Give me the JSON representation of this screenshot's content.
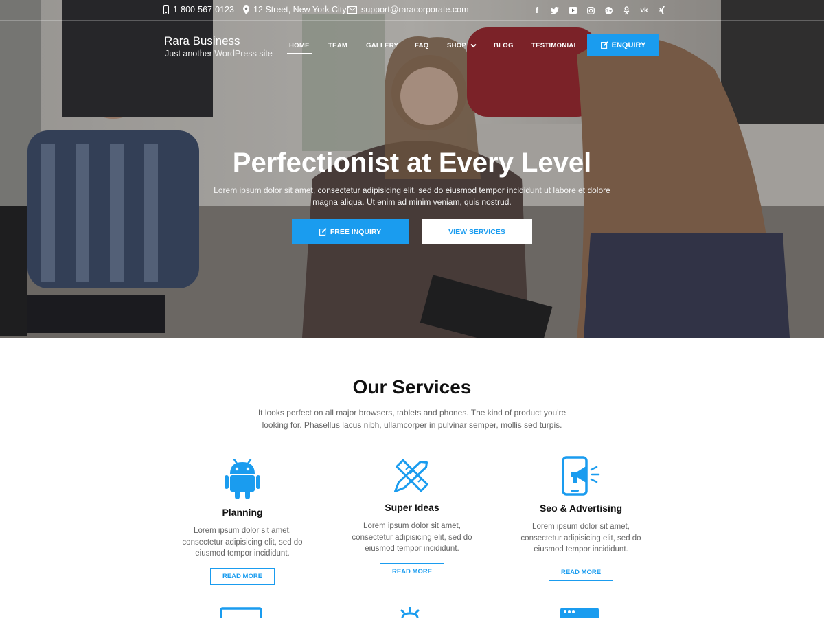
{
  "topbar": {
    "phone": "1-800-567-0123",
    "address": "12 Street, New York City",
    "email": "support@raracorporate.com",
    "social_icons": [
      "facebook-icon",
      "twitter-icon",
      "youtube-icon",
      "instagram-icon",
      "google-plus-icon",
      "odnoklassniki-icon",
      "vk-icon",
      "xing-icon"
    ]
  },
  "header": {
    "site_title": "Rara Business",
    "tagline": "Just another WordPress site",
    "nav": [
      {
        "label": "HOME",
        "active": true
      },
      {
        "label": "TEAM"
      },
      {
        "label": "GALLERY"
      },
      {
        "label": "FAQ"
      },
      {
        "label": "SHOP"
      },
      {
        "label": "BLOG"
      },
      {
        "label": "TESTIMONIAL"
      }
    ],
    "enquiry_label": "ENQUIRY"
  },
  "hero": {
    "title": "Perfectionist at Every Level",
    "subtitle": "Lorem ipsum dolor sit amet, consectetur adipisicing elit, sed do eiusmod tempor incididunt ut labore et dolore magna aliqua. Ut enim ad minim veniam, quis nostrud.",
    "primary_button": "FREE INQUIRY",
    "secondary_button": "VIEW SERVICES"
  },
  "services": {
    "title": "Our Services",
    "description": "It looks perfect on all major browsers, tablets and phones. The kind of product you're looking for. Phasellus lacus nibh, ullamcorper in pulvinar semper, mollis sed turpis.",
    "items": [
      {
        "icon": "android-icon",
        "title": "Planning",
        "text": "Lorem ipsum dolor sit amet, consectetur adipisicing elit, sed do eiusmod tempor incididunt.",
        "button": "READ MORE"
      },
      {
        "icon": "ruler-pencil-icon",
        "title": "Super Ideas",
        "text": "Lorem ipsum dolor sit amet, consectetur adipisicing elit, sed do eiusmod tempor incididunt.",
        "button": "READ MORE"
      },
      {
        "icon": "mobile-megaphone-icon",
        "title": "Seo & Advertising",
        "text": "Lorem ipsum dolor sit amet, consectetur adipisicing elit, sed do eiusmod tempor incididunt.",
        "button": "READ MORE"
      }
    ]
  },
  "colors": {
    "accent": "#1a9cef",
    "heading": "#111111",
    "body_text": "#666666"
  }
}
